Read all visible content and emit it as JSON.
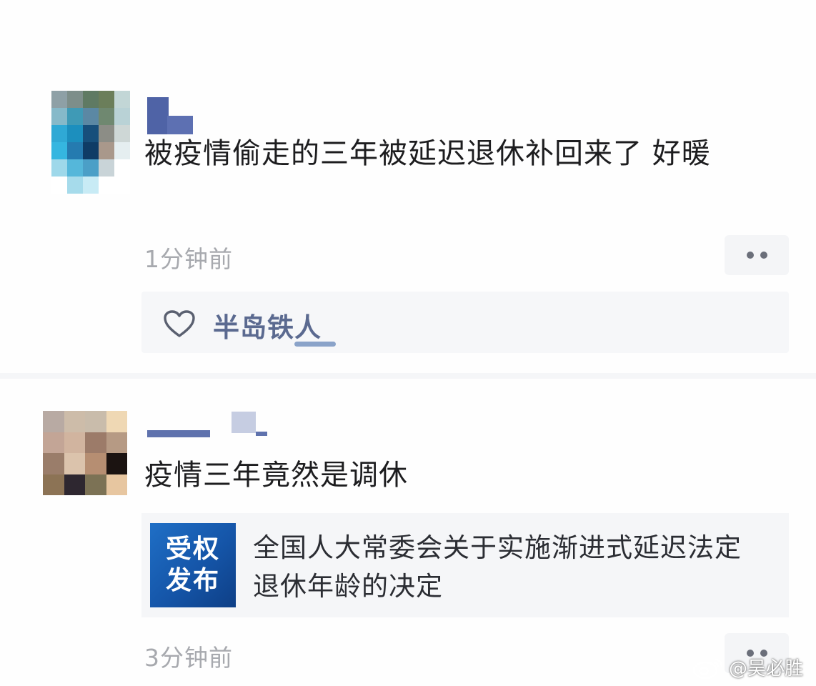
{
  "comments": [
    {
      "text": "被疫情偷走的三年被延迟退休补回来了 好暖",
      "time": "1分钟前",
      "liked_by": "半岛铁人"
    },
    {
      "text": "疫情三年竟然是调休",
      "time": "3分钟前",
      "link": {
        "badge_line1": "受权",
        "badge_line2": "发布",
        "title": "全国人大常委会关于实施渐进式延迟法定退休年龄的决定"
      }
    }
  ],
  "watermark": "@吴必胜",
  "colors": {
    "accent_link": "#5b6a90",
    "badge_blue": "#1555a8",
    "timestamp": "#a7a9ae"
  },
  "icons": [
    "heart-icon",
    "more-icon",
    "weibo-logo-icon"
  ]
}
